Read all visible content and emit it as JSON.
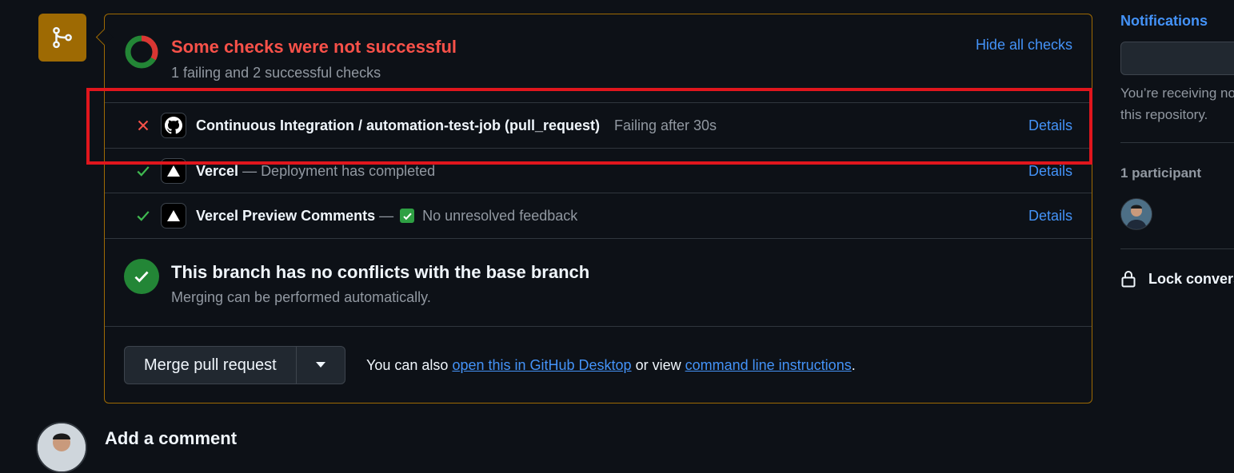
{
  "merge_box": {
    "status_title": "Some checks were not successful",
    "status_summary": "1 failing and 2 successful checks",
    "hide_checks_label": "Hide all checks",
    "checks": [
      {
        "status": "failure",
        "app_icon": "github-icon",
        "name": "Continuous Integration / automation-test-job (pull_request)",
        "description": "Failing after 30s",
        "details_label": "Details"
      },
      {
        "status": "success",
        "app_icon": "vercel-icon",
        "name": "Vercel",
        "dash": "—",
        "description": "Deployment has completed",
        "details_label": "Details"
      },
      {
        "status": "success",
        "app_icon": "vercel-icon",
        "name": "Vercel Preview Comments",
        "dash": "—",
        "description": "No unresolved feedback",
        "details_label": "Details"
      }
    ],
    "conflict_title": "This branch has no conflicts with the base branch",
    "conflict_subtitle": "Merging can be performed automatically.",
    "merge_button_label": "Merge pull request",
    "merge_hint_prefix": "You can also",
    "desktop_link": "open this in GitHub Desktop",
    "merge_hint_middle": "or view",
    "cli_link": "command line instructions",
    "merge_hint_suffix": "."
  },
  "sidebar": {
    "notifications_heading": "Notifications",
    "notifications_text_line1": "You’re receiving no",
    "notifications_text_line2": "this repository.",
    "participants_heading": "1 participant",
    "lock_label": "Lock conversation"
  },
  "comment": {
    "heading": "Add a comment"
  },
  "colors": {
    "background": "#0d1117",
    "failure": "#f85149",
    "success": "#3fb950",
    "link": "#4493f8",
    "warning_border": "#9e6a03",
    "highlight": "#e0161d"
  }
}
